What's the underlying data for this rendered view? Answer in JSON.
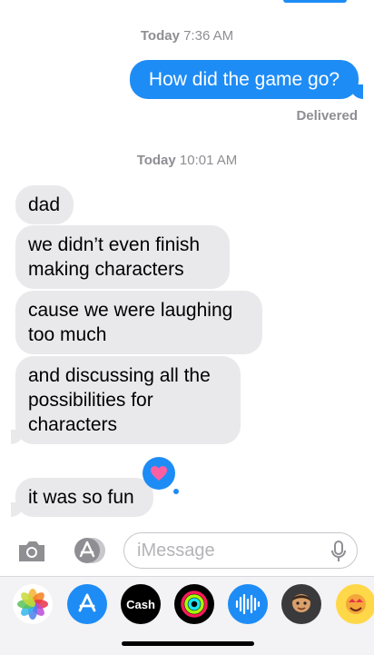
{
  "conversation": {
    "timestamps": [
      {
        "day": "Today",
        "time": "7:36 AM"
      },
      {
        "day": "Today",
        "time": "10:01 AM"
      }
    ],
    "outgoing": [
      {
        "text": "How did the game go?"
      }
    ],
    "delivered_label": "Delivered",
    "incoming": [
      {
        "lines": [
          "dad"
        ]
      },
      {
        "lines": [
          "we didn’t even finish",
          "making characters"
        ]
      },
      {
        "lines": [
          "cause we were laughing",
          "too much"
        ]
      },
      {
        "lines": [
          "and discussing all the",
          "possibilities for",
          "characters"
        ]
      },
      {
        "lines": [
          "it was so fun"
        ]
      }
    ],
    "tapback": {
      "icon": "heart-icon",
      "color": "#ff5fa2",
      "on_message": 4
    }
  },
  "input_bar": {
    "placeholder": "iMessage",
    "camera_icon": "camera-icon",
    "apps_icon": "app-store-icon",
    "mic_icon": "microphone-icon"
  },
  "app_tray": {
    "apps": [
      {
        "name": "photos-icon"
      },
      {
        "name": "app-store-icon"
      },
      {
        "name": "apple-cash-icon",
        "label": "Cash"
      },
      {
        "name": "activity-rings-icon"
      },
      {
        "name": "audio-message-icon"
      },
      {
        "name": "memoji-icon"
      },
      {
        "name": "memoji-stickers-icon"
      }
    ]
  },
  "colors": {
    "accent": "#1e8cf5",
    "incoming_bubble": "#e9e9eb",
    "meta_text": "#8e8e93"
  }
}
